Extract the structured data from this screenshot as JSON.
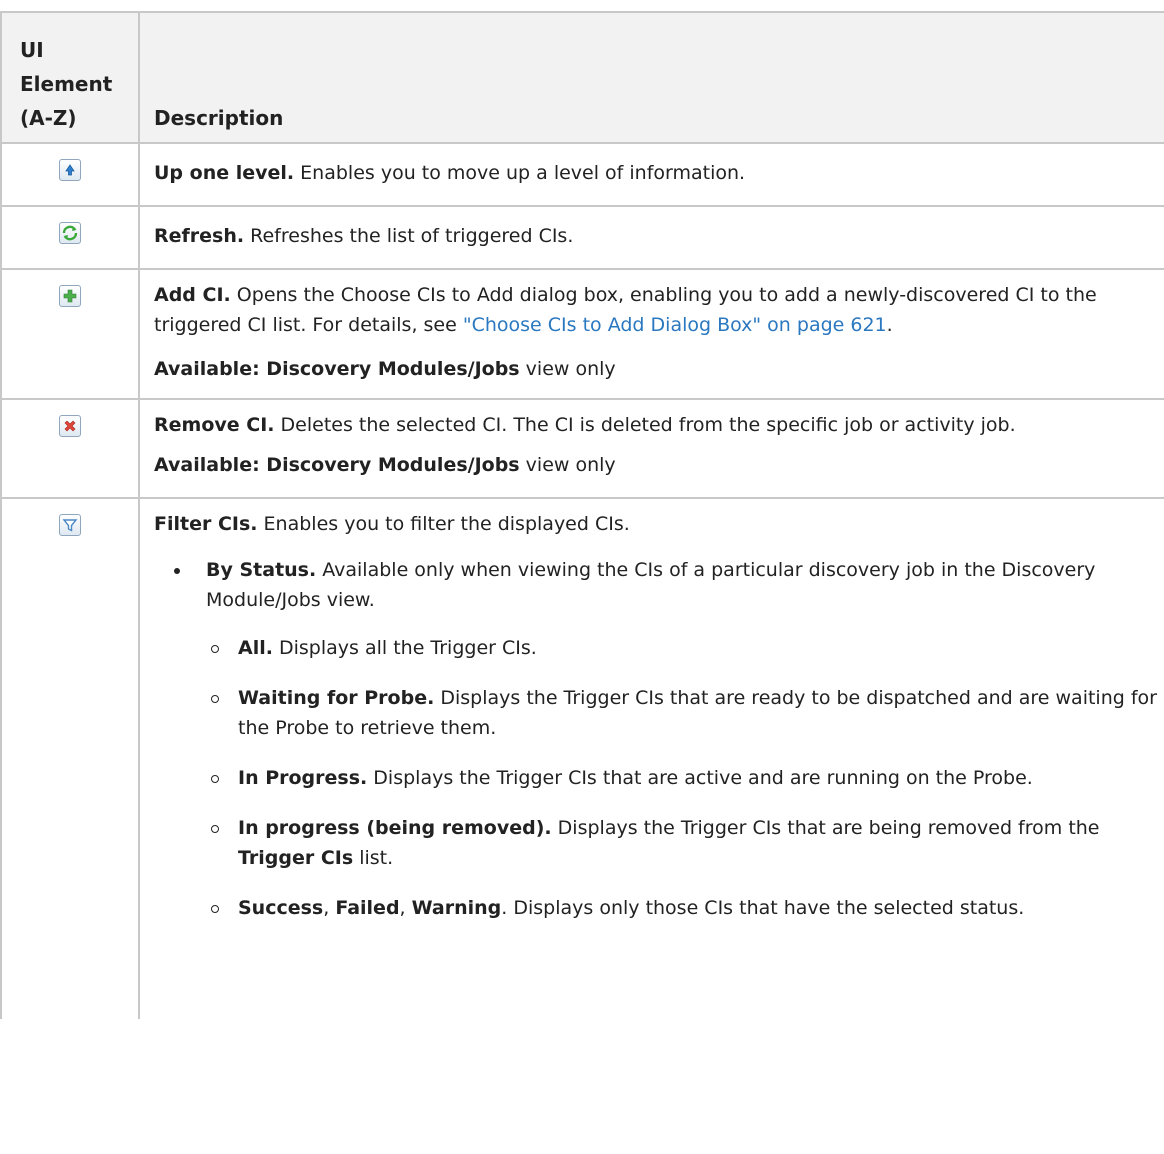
{
  "header": {
    "col1_line1": "UI",
    "col1_line2": "Element",
    "col1_line3": "(A-Z)",
    "col2": "Description"
  },
  "rows": [
    {
      "icon": "up-one-level-icon",
      "title": "Up one level.",
      "text": " Enables you to move up a level of information."
    },
    {
      "icon": "refresh-icon",
      "title": "Refresh.",
      "text": " Refreshes the list of triggered CIs."
    },
    {
      "icon": "add-ci-icon",
      "title": "Add CI.",
      "text1": " Opens the Choose CIs to Add dialog box, enabling you to add a newly-discovered CI to the triggered CI list. For details, see ",
      "link": "\"Choose CIs to Add Dialog Box\" on page 621",
      "text2": ".",
      "avail_bold": "Available: Discovery Modules/Jobs",
      "avail_text": " view only"
    },
    {
      "icon": "remove-ci-icon",
      "title": "Remove CI.",
      "text": " Deletes the selected CI. The CI is deleted from the specific job or activity job.",
      "avail_bold": "Available: Discovery Modules/Jobs",
      "avail_text": " view only"
    },
    {
      "icon": "filter-icon",
      "title": "Filter CIs.",
      "text": " Enables you to filter the displayed CIs.",
      "bullet_title": "By Status.",
      "bullet_text": " Available only when viewing the CIs of a particular discovery job in the Discovery Module/Jobs view.",
      "subs": [
        {
          "title": "All.",
          "text": " Displays all the Trigger CIs."
        },
        {
          "title": "Waiting for Probe.",
          "text": " Displays the Trigger CIs that are ready to be dispatched and are waiting for the Probe to retrieve them."
        },
        {
          "title": "In Progress.",
          "text": " Displays the Trigger CIs that are active and are running on the Probe."
        },
        {
          "title": "In progress (being removed).",
          "text_a": " Displays the Trigger CIs that are being removed from the ",
          "bold_b": "Trigger CIs",
          "text_c": " list."
        },
        {
          "b1": "Success",
          "s1": ", ",
          "b2": "Failed",
          "s2": ", ",
          "b3": "Warning",
          "text": ". Displays only those CIs that have the selected status."
        }
      ]
    }
  ],
  "colors": {
    "border": "#c8c8c8",
    "header_bg": "#f2f2f2",
    "link": "#2a78c0"
  }
}
